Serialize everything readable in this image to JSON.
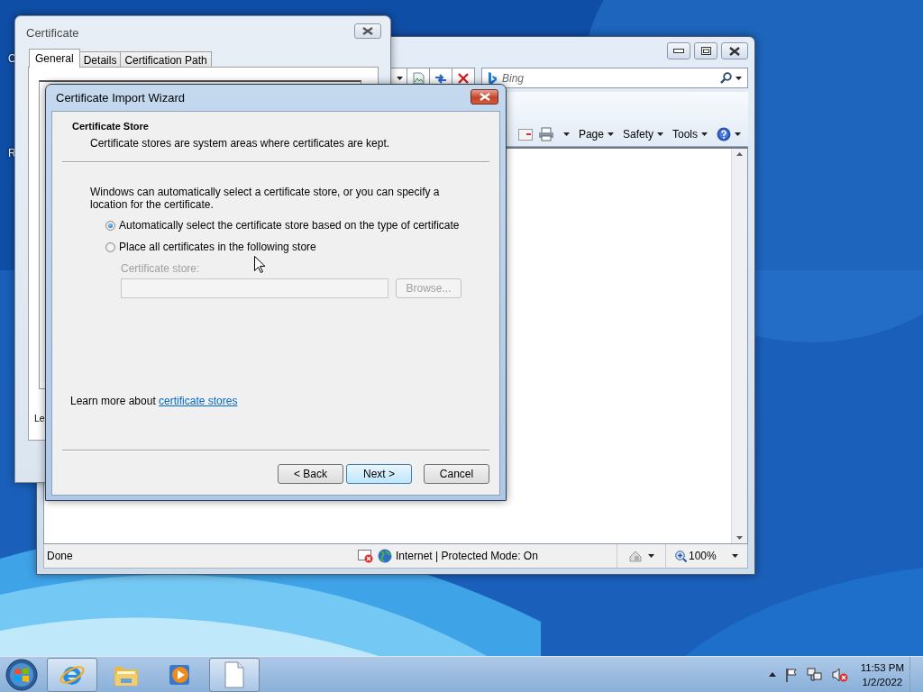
{
  "desktop": {
    "icon_labels": [
      "C",
      "R"
    ]
  },
  "browser_window": {
    "search": {
      "placeholder": "Bing"
    },
    "command_bar": [
      {
        "label": "Page"
      },
      {
        "label": "Safety"
      },
      {
        "label": "Tools"
      }
    ],
    "status_bar": {
      "status": "Done",
      "zone": "Internet | Protected Mode: On",
      "zoom": "100%"
    }
  },
  "certificate_window": {
    "title": "Certificate",
    "tabs": [
      {
        "label": "General",
        "selected": true
      },
      {
        "label": "Details",
        "selected": false
      },
      {
        "label": "Certification Path",
        "selected": false
      }
    ],
    "panel_text": "Le"
  },
  "wizard": {
    "title": "Certificate Import Wizard",
    "heading": "Certificate Store",
    "subheading": "Certificate stores are system areas where certificates are kept.",
    "description": "Windows can automatically select a certificate store, or you can specify a location for the certificate.",
    "options": [
      {
        "label": "Automatically select the certificate store based on the type of certificate",
        "selected": true
      },
      {
        "label": "Place all certificates in the following store",
        "selected": false
      }
    ],
    "store_field": {
      "label": "Certificate store:",
      "disabled": true
    },
    "browse_button": {
      "label": "Browse...",
      "disabled": true
    },
    "learn_more": {
      "text": "Learn more about",
      "link": "certificate stores"
    },
    "buttons": [
      {
        "label": "< Back",
        "default": false
      },
      {
        "label": "Next >",
        "default": true
      },
      {
        "label": "Cancel",
        "default": false
      }
    ]
  },
  "taskbar": {
    "apps": [
      {
        "kind": "browser",
        "active": true
      },
      {
        "kind": "folder",
        "active": false
      },
      {
        "kind": "media",
        "active": false
      },
      {
        "kind": "document",
        "active": true
      }
    ],
    "clock": {
      "time": "11:53 PM",
      "date": "1/2/2022"
    }
  }
}
